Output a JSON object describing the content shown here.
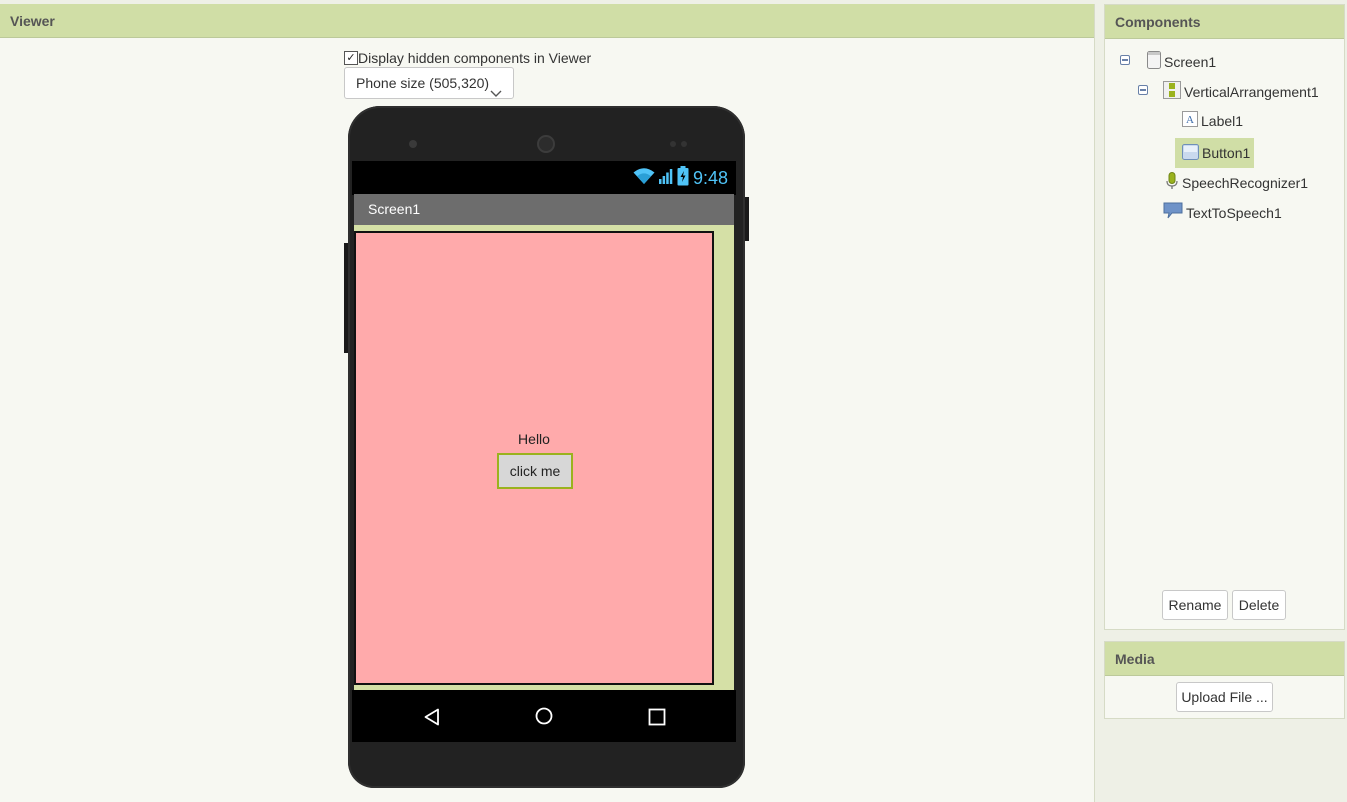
{
  "viewer": {
    "title": "Viewer",
    "display_hidden_label": "Display hidden components in Viewer",
    "display_hidden_checked": true,
    "phone_size": "Phone size (505,320)"
  },
  "phone": {
    "clock": "9:48",
    "screen_title": "Screen1",
    "label_text": "Hello",
    "button_text": "click me",
    "colors": {
      "arrangement_bg": "#ffaaab",
      "screen_bg": "#d5e0a6",
      "title_bar": "#6d6d6d",
      "clock": "#4fc3f7"
    }
  },
  "components": {
    "title": "Components",
    "tree": [
      {
        "label": "Screen1",
        "icon": "screen-icon",
        "expanded": true
      },
      {
        "label": "VerticalArrangement1",
        "icon": "vertical-arrangement-icon",
        "expanded": true
      },
      {
        "label": "Label1",
        "icon": "label-icon"
      },
      {
        "label": "Button1",
        "icon": "button-icon",
        "selected": true
      },
      {
        "label": "SpeechRecognizer1",
        "icon": "microphone-icon"
      },
      {
        "label": "TextToSpeech1",
        "icon": "speech-bubble-icon"
      }
    ],
    "rename_label": "Rename",
    "delete_label": "Delete"
  },
  "media": {
    "title": "Media",
    "upload_label": "Upload File ..."
  },
  "colors": {
    "header": "#d0dea6",
    "panel": "#f7f8f2",
    "selected": "#d0dea6"
  }
}
